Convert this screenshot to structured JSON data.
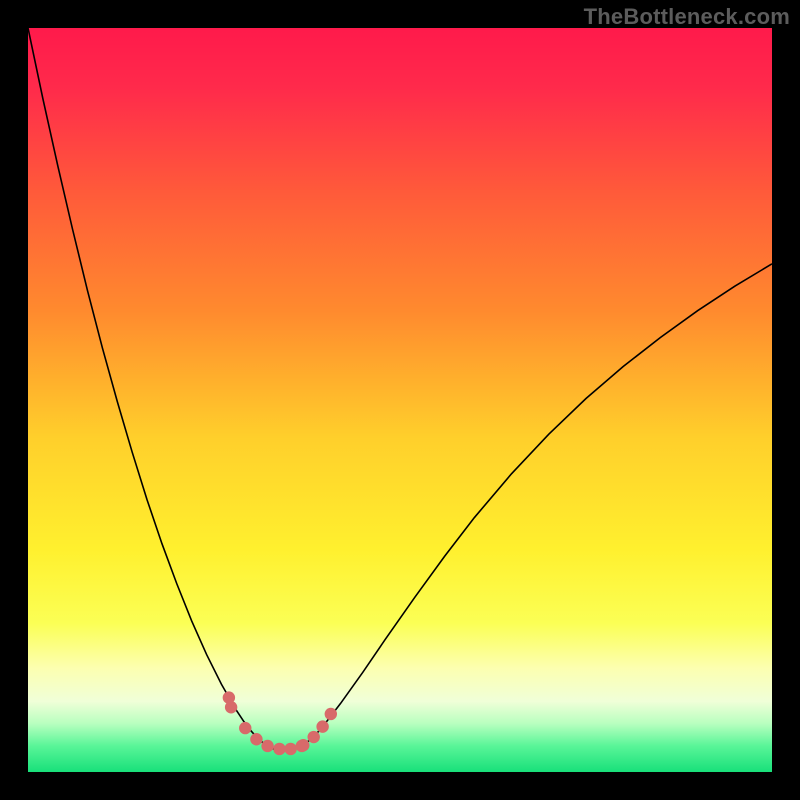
{
  "watermark": "TheBottleneck.com",
  "chart_data": {
    "type": "line",
    "title": "",
    "xlabel": "",
    "ylabel": "",
    "xlim": [
      0,
      100
    ],
    "ylim": [
      0,
      100
    ],
    "axes_visible": false,
    "grid": false,
    "background_gradient": {
      "stops": [
        {
          "offset": 0.0,
          "color": "#ff1a4b"
        },
        {
          "offset": 0.08,
          "color": "#ff2a4b"
        },
        {
          "offset": 0.22,
          "color": "#ff5a3a"
        },
        {
          "offset": 0.38,
          "color": "#ff8a2e"
        },
        {
          "offset": 0.55,
          "color": "#ffcf2b"
        },
        {
          "offset": 0.7,
          "color": "#fff02e"
        },
        {
          "offset": 0.8,
          "color": "#fbff55"
        },
        {
          "offset": 0.86,
          "color": "#fcffb0"
        },
        {
          "offset": 0.905,
          "color": "#f0ffd8"
        },
        {
          "offset": 0.935,
          "color": "#b8ffbf"
        },
        {
          "offset": 0.965,
          "color": "#59f598"
        },
        {
          "offset": 1.0,
          "color": "#18e07a"
        }
      ]
    },
    "series": [
      {
        "name": "curve",
        "color": "#000000",
        "stroke_width": 1.6,
        "x": [
          0.0,
          2,
          4,
          6,
          8,
          10,
          12,
          14,
          16,
          18,
          20,
          22,
          24,
          26,
          28,
          29,
          30,
          31,
          32,
          33,
          34,
          35,
          36,
          37,
          38,
          39,
          40,
          42,
          45,
          48,
          52,
          56,
          60,
          65,
          70,
          75,
          80,
          85,
          90,
          95,
          100
        ],
        "y": [
          100,
          90.5,
          81.5,
          72.9,
          64.7,
          57.0,
          49.8,
          43.0,
          36.6,
          30.7,
          25.3,
          20.3,
          15.8,
          11.8,
          8.3,
          6.8,
          5.5,
          4.4,
          3.6,
          3.1,
          2.9,
          2.9,
          3.1,
          3.6,
          4.4,
          5.4,
          6.6,
          9.2,
          13.4,
          17.8,
          23.5,
          29.0,
          34.2,
          40.1,
          45.4,
          50.2,
          54.5,
          58.4,
          62.0,
          65.3,
          68.3
        ]
      },
      {
        "name": "markers",
        "type": "scatter",
        "color": "#d86a6a",
        "radius": 6.2,
        "x": [
          27.0,
          27.3,
          29.2,
          30.7,
          32.2,
          33.8,
          35.3,
          36.8,
          37.0,
          38.4,
          39.6,
          40.7
        ],
        "y": [
          10.0,
          8.7,
          5.9,
          4.4,
          3.5,
          3.1,
          3.1,
          3.5,
          3.6,
          4.7,
          6.1,
          7.8
        ]
      }
    ]
  }
}
